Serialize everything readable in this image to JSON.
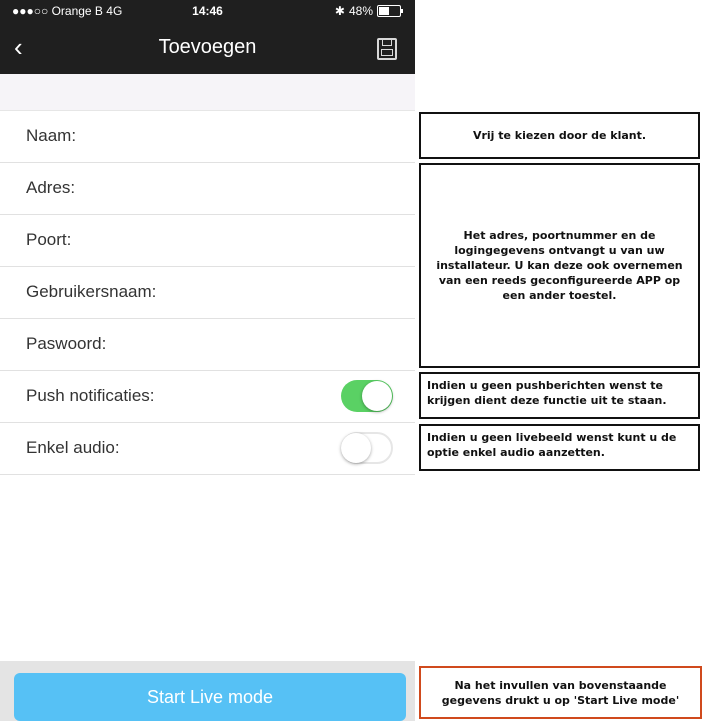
{
  "status_bar": {
    "carrier": "●●●○○ Orange B  4G",
    "time": "14:46",
    "battery": "48%",
    "battery_level": 0.48
  },
  "nav": {
    "title": "Toevoegen",
    "back_icon": "chevron-left-icon",
    "save_icon": "floppy-disk-icon"
  },
  "form": {
    "fields": [
      {
        "label": "Naam:"
      },
      {
        "label": "Adres:"
      },
      {
        "label": "Poort:"
      },
      {
        "label": "Gebruikersnaam:"
      },
      {
        "label": "Paswoord:"
      }
    ],
    "toggles": [
      {
        "label": "Push notificaties:",
        "on": true
      },
      {
        "label": "Enkel audio:",
        "on": false
      }
    ]
  },
  "start_button": {
    "label": "Start Live mode"
  },
  "annotations": {
    "naam": "Vrij te kiezen door de klant.",
    "adres": "Het adres, poortnummer en de logingegevens ontvangt u van uw installateur. U kan deze ook overnemen van een reeds geconfigureerde APP op een ander toestel.",
    "push": "Indien u geen pushberichten wenst te krijgen dient deze functie uit te staan.",
    "audio": "Indien u geen livebeeld wenst kunt u de optie enkel audio aanzetten.",
    "start": "Na het invullen van bovenstaande gegevens drukt u op 'Start Live mode'"
  },
  "colors": {
    "toggle_on": "#5ad164",
    "button": "#56c1f5",
    "start_note_border": "#d04a1d"
  }
}
